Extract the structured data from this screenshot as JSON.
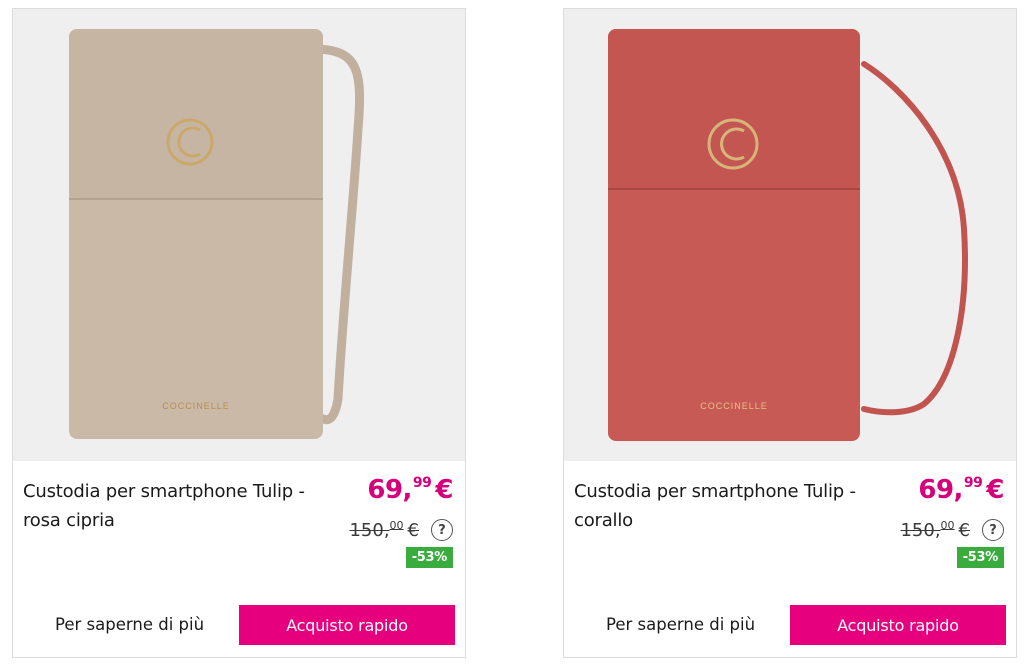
{
  "products": [
    {
      "name": "Custodia per smartphone Tulip - rosa cipria",
      "price_int": "69,",
      "price_dec": "99",
      "currency": "€",
      "old_price_int": "150,",
      "old_price_dec": "00",
      "old_currency": "€",
      "help": "?",
      "discount": "-53%",
      "more_label": "Per saperne di più",
      "buy_label": "Acquisto rapido",
      "brand": "COCCINELLE",
      "bag_color": "#cbb9a8",
      "strap_color": "#c2b09f"
    },
    {
      "name": "Custodia per smartphone Tulip - corallo",
      "price_int": "69,",
      "price_dec": "99",
      "currency": "€",
      "old_price_int": "150,",
      "old_price_dec": "00",
      "old_currency": "€",
      "help": "?",
      "discount": "-53%",
      "more_label": "Per saperne di più",
      "buy_label": "Acquisto rapido",
      "brand": "COCCINELLE",
      "bag_color": "#c85a55",
      "strap_color": "#c25450"
    }
  ],
  "colors": {
    "accent": "#e6007e",
    "price": "#d6007a",
    "badge": "#3aac3e"
  }
}
